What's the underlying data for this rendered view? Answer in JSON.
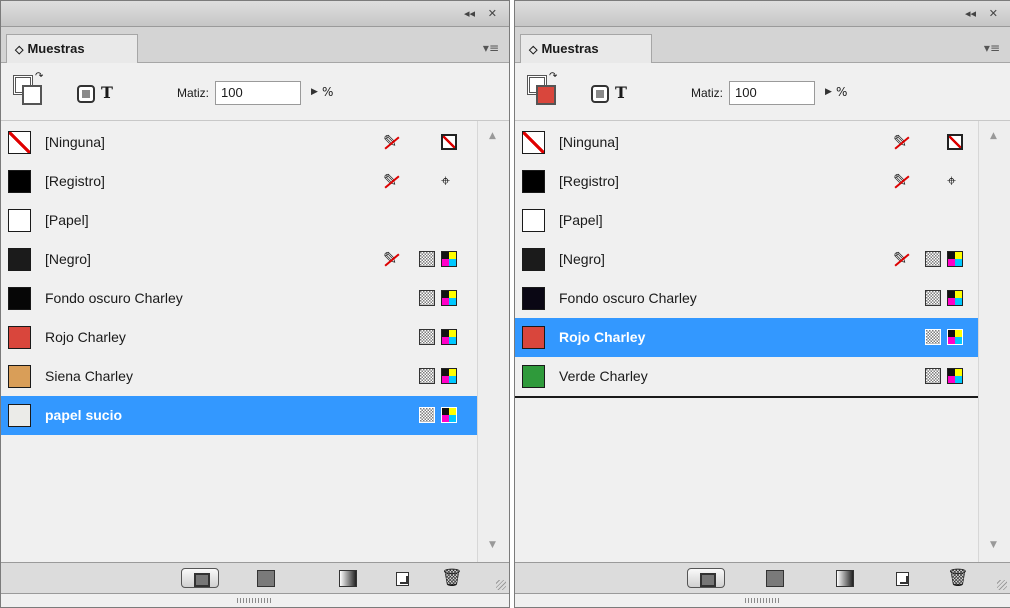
{
  "colors": {
    "selection": "#3398ff",
    "panel_bg": "#f0f0f0"
  },
  "panels": [
    {
      "title_controls": {
        "collapse": "◂◂",
        "close": "✕"
      },
      "tab_label": "Muestras",
      "tab_arrows": "◇",
      "menu_icon": "▾≡",
      "fill_stroke": {
        "fill_color": "#ffffff",
        "stroke_color": "#ffffff"
      },
      "tint": {
        "label": "Matiz:",
        "value": "100",
        "unit": "%"
      },
      "swatches": [
        {
          "name": "[Ninguna]",
          "color": "none",
          "icons": [
            "no-edit",
            "stroke-none"
          ],
          "selected": false
        },
        {
          "name": "[Registro]",
          "color": "#000000",
          "icons": [
            "no-edit",
            "registration"
          ],
          "selected": false
        },
        {
          "name": "[Papel]",
          "color": "#ffffff",
          "icons": [],
          "selected": false
        },
        {
          "name": "[Negro]",
          "color": "#1b1b1b",
          "icons": [
            "no-edit",
            "process",
            "cmyk"
          ],
          "selected": false
        },
        {
          "name": "Fondo oscuro Charley",
          "color": "#060606",
          "icons": [
            "process",
            "cmyk"
          ],
          "selected": false
        },
        {
          "name": "Rojo Charley",
          "color": "#d9463c",
          "icons": [
            "process",
            "cmyk"
          ],
          "selected": false
        },
        {
          "name": "Siena Charley",
          "color": "#d99e58",
          "icons": [
            "process",
            "cmyk"
          ],
          "selected": false
        },
        {
          "name": "papel sucio",
          "color": "#ebebe8",
          "icons": [
            "process",
            "cmyk"
          ],
          "selected": true
        }
      ]
    },
    {
      "title_controls": {
        "collapse": "◂◂",
        "close": "✕"
      },
      "tab_label": "Muestras",
      "tab_arrows": "◇",
      "menu_icon": "▾≡",
      "fill_stroke": {
        "fill_color": "#d9463c",
        "stroke_color": "#ffffff"
      },
      "tint": {
        "label": "Matiz:",
        "value": "100",
        "unit": "%"
      },
      "swatches": [
        {
          "name": "[Ninguna]",
          "color": "none",
          "icons": [
            "no-edit",
            "stroke-none"
          ],
          "selected": false
        },
        {
          "name": "[Registro]",
          "color": "#000000",
          "icons": [
            "no-edit",
            "registration"
          ],
          "selected": false
        },
        {
          "name": "[Papel]",
          "color": "#ffffff",
          "icons": [],
          "selected": false
        },
        {
          "name": "[Negro]",
          "color": "#1b1b1b",
          "icons": [
            "no-edit",
            "process",
            "cmyk"
          ],
          "selected": false
        },
        {
          "name": "Fondo oscuro Charley",
          "color": "#0a0714",
          "icons": [
            "process",
            "cmyk"
          ],
          "selected": false
        },
        {
          "name": "Rojo Charley",
          "color": "#d9463c",
          "icons": [
            "process",
            "cmyk"
          ],
          "selected": true
        },
        {
          "name": "Verde Charley",
          "color": "#2f9a3b",
          "icons": [
            "process",
            "cmyk"
          ],
          "selected": false
        }
      ]
    }
  ]
}
